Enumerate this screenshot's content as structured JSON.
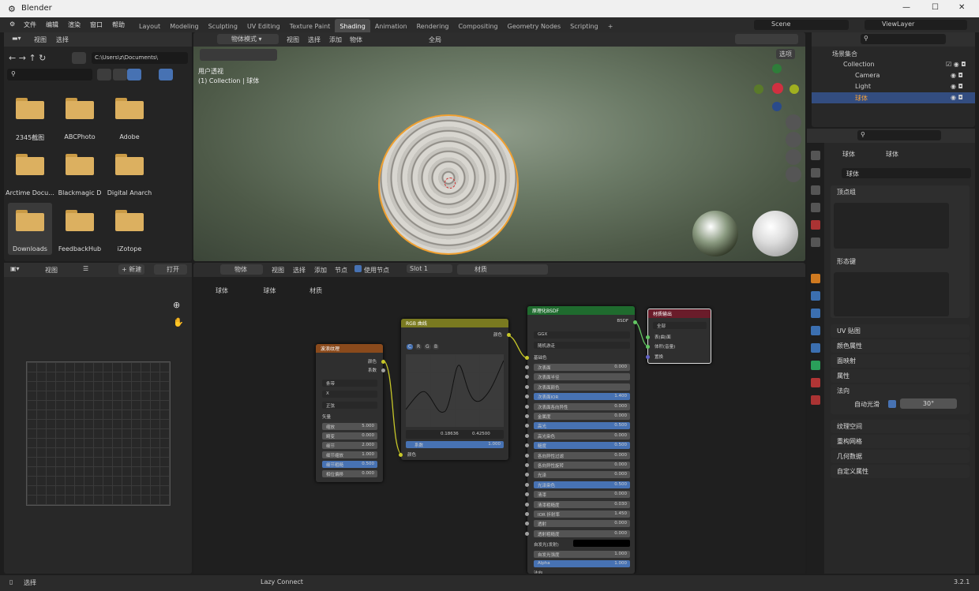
{
  "window": {
    "app": "Blender",
    "min": "—",
    "max": "☐",
    "close": "✕"
  },
  "menu": [
    "文件",
    "编辑",
    "渲染",
    "窗口",
    "帮助"
  ],
  "workspaces": [
    "Layout",
    "Modeling",
    "Sculpting",
    "UV Editing",
    "Texture Paint",
    "Shading",
    "Animation",
    "Rendering",
    "Compositing",
    "Geometry Nodes",
    "Scripting",
    "+"
  ],
  "scene": "Scene",
  "viewlayer": "ViewLayer",
  "filebrowser": {
    "menu": [
      "视图",
      "选择"
    ],
    "path": "C:\\Users\\z\\Documents\\",
    "folders": [
      "2345截图",
      "ABCPhoto",
      "Adobe",
      "Arctime Docu...",
      "Blackmagic D",
      "Digital Anarch",
      "Downloads",
      "FeedbackHub",
      "iZotope"
    ]
  },
  "viewport": {
    "mode": "物体模式",
    "menu": [
      "视图",
      "选择",
      "添加",
      "物体"
    ],
    "global": "全局",
    "options": "选项",
    "overlay1": "用户透视",
    "overlay2": "(1) Collection | 球体"
  },
  "imageeditor": {
    "menu": [
      "视图"
    ],
    "new": "+ 新建",
    "open": "打开"
  },
  "nodeeditor": {
    "type": "物体",
    "menu": [
      "视图",
      "选择",
      "添加",
      "节点"
    ],
    "usenodes": "使用节点",
    "slot": "Slot 1",
    "material": "材质",
    "crumbs": [
      "球体",
      "球体",
      "材质"
    ]
  },
  "nodes": {
    "wave": {
      "title": "波浪纹理",
      "out1": "颜色",
      "out2": "系数",
      "d1": "条带",
      "d2": "X",
      "d3": "正弦",
      "vec": "矢量",
      "rows": [
        [
          "缩放",
          "5.000"
        ],
        [
          "畸变",
          "0.000"
        ],
        [
          "细节",
          "2.000"
        ],
        [
          "细节缩放",
          "1.000"
        ],
        [
          "细节粗糙",
          "0.500"
        ],
        [
          "相位偏移",
          "0.000"
        ]
      ]
    },
    "rgb": {
      "title": "RGB 曲线",
      "out": "颜色",
      "btns": [
        "C",
        "R",
        "G",
        "B"
      ],
      "v1": "0.18636",
      "v2": "0.42500",
      "fac": "系数",
      "facv": "1.000",
      "col": "颜色"
    },
    "bsdf": {
      "title": "原理化BSDF",
      "out": "BSDF",
      "d1": "GGX",
      "d2": "随机游走",
      "base": "基础色",
      "rows": [
        [
          "次表面",
          "0.000"
        ],
        [
          "次表面半径",
          ""
        ],
        [
          "次表面颜色",
          ""
        ],
        [
          "次表面IOR",
          "1.400"
        ],
        [
          "次表面各向异性",
          "0.000"
        ],
        [
          "金属度",
          "0.000"
        ],
        [
          "高光",
          "0.500"
        ],
        [
          "高光染色",
          "0.000"
        ],
        [
          "糙度",
          "0.500"
        ],
        [
          "各向异性过滤",
          "0.000"
        ],
        [
          "各向异性旋转",
          "0.000"
        ],
        [
          "光泽",
          "0.000"
        ],
        [
          "光泽染色",
          "0.500"
        ],
        [
          "清漆",
          "0.000"
        ],
        [
          "清漆粗糙度",
          "0.030"
        ],
        [
          "IOR 折射率",
          "1.450"
        ],
        [
          "透射",
          "0.000"
        ],
        [
          "透射粗糙度",
          "0.000"
        ]
      ],
      "emission": "自发光(发射)",
      "emstr": [
        "自发光强度",
        "1.000"
      ],
      "alpha": [
        "Alpha",
        "1.000"
      ],
      "normal": "法向"
    },
    "out": {
      "title": "材质输出",
      "d": "全部",
      "s1": "表(曲)面",
      "s2": "体积(音量)",
      "s3": "置换"
    }
  },
  "outliner": {
    "root": "场景集合",
    "items": [
      "Collection",
      "Camera",
      "Light",
      "球体"
    ]
  },
  "properties": {
    "crumb1": "球体",
    "crumb2": "球体",
    "mesh": "球体",
    "sections": [
      "顶点组",
      "形态键",
      "UV 贴图",
      "颜色属性",
      "面映射",
      "属性",
      "法向",
      "纹理空间",
      "重构网格",
      "几何数据",
      "自定义属性"
    ],
    "autosmooth": "自动光滑",
    "angle": "30°"
  },
  "status": {
    "left": "选择",
    "mid": "Lazy Connect",
    "version": "3.2.1"
  }
}
